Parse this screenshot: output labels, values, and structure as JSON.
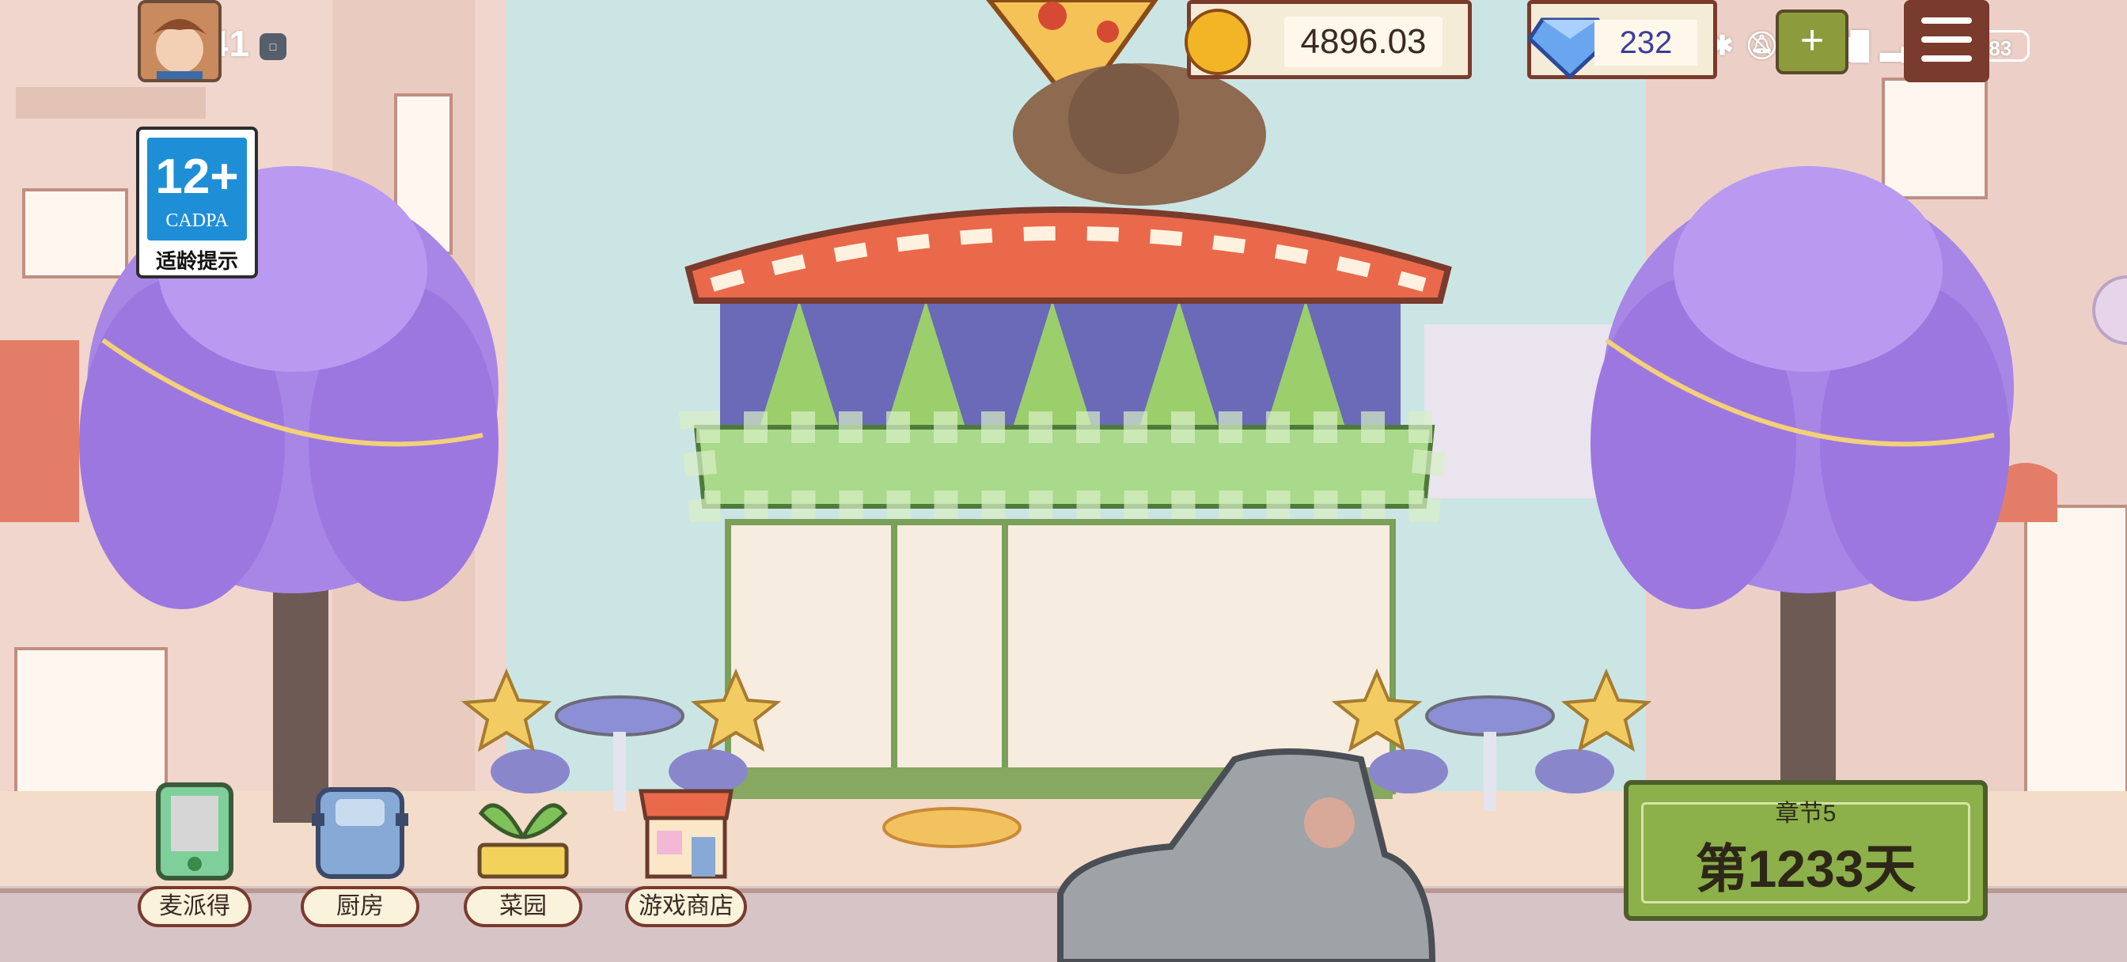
{
  "status_bar": {
    "time": "11:41",
    "battery": "83"
  },
  "age_rating": {
    "age": "12+",
    "org": "CADPA",
    "tip": "适龄提示"
  },
  "currency": {
    "coins": "4896.03",
    "gems": "232"
  },
  "nav": [
    {
      "label": "麦派得",
      "icon": "tablet-icon"
    },
    {
      "label": "厨房",
      "icon": "stove-icon"
    },
    {
      "label": "菜园",
      "icon": "sprout-icon"
    },
    {
      "label": "游戏商店",
      "icon": "shop-icon"
    }
  ],
  "chapter": {
    "subtitle": "章节5",
    "day": "第1233天"
  },
  "colors": {
    "accent": "#7a3a2c",
    "panel_green": "#8cb04a",
    "coin": "#f1b526"
  }
}
